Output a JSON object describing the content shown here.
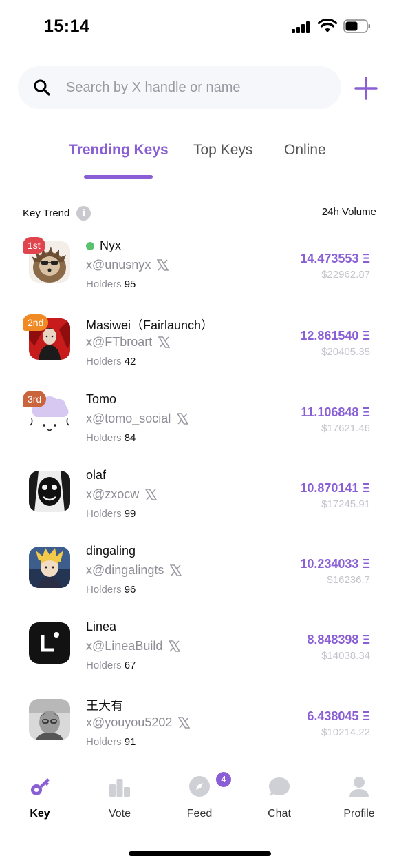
{
  "status_bar": {
    "time": "15:14"
  },
  "search": {
    "placeholder": "Search by X handle or name",
    "value": ""
  },
  "tabs": [
    {
      "label": "Trending Keys",
      "active": true
    },
    {
      "label": "Top Keys",
      "active": false
    },
    {
      "label": "Online",
      "active": false
    }
  ],
  "list_header": {
    "left": "Key Trend",
    "info_glyph": "i",
    "right": "24h Volume"
  },
  "holders_label": "Holders",
  "rows": [
    {
      "rank": "1st",
      "rank_color": "#e0454e",
      "name": "Nyx",
      "online": true,
      "handle": "x@unusnyx",
      "holders": "95",
      "volume": "14.473553 Ξ",
      "usd": "$22962.87",
      "avatar": "hedgehog-avatar"
    },
    {
      "rank": "2nd",
      "rank_color": "#f08a24",
      "name": "Masiwei（Fairlaunch）",
      "online": false,
      "handle": "x@FTbroart",
      "holders": "42",
      "volume": "12.861540 Ξ",
      "usd": "$20405.35",
      "avatar": "red-figure-avatar"
    },
    {
      "rank": "3rd",
      "rank_color": "#c9643c",
      "name": "Tomo",
      "online": false,
      "handle": "x@tomo_social",
      "holders": "84",
      "volume": "11.106848 Ξ",
      "usd": "$17621.46",
      "avatar": "cat-avatar"
    },
    {
      "rank": "",
      "rank_color": "",
      "name": "olaf",
      "online": false,
      "handle": "x@zxocw",
      "holders": "99",
      "volume": "10.870141 Ξ",
      "usd": "$17245.91",
      "avatar": "bw-face-avatar"
    },
    {
      "rank": "",
      "rank_color": "",
      "name": "dingaling",
      "online": false,
      "handle": "x@dingalingts",
      "holders": "96",
      "volume": "10.234033 Ξ",
      "usd": "$16236.7",
      "avatar": "anime-avatar"
    },
    {
      "rank": "",
      "rank_color": "",
      "name": "Linea",
      "online": false,
      "handle": "x@LineaBuild",
      "holders": "67",
      "volume": "8.848398 Ξ",
      "usd": "$14038.34",
      "avatar": "linea-logo-avatar"
    },
    {
      "rank": "",
      "rank_color": "",
      "name": "王大有",
      "online": false,
      "handle": "x@youyou5202",
      "holders": "91",
      "volume": "6.438045 Ξ",
      "usd": "$10214.22",
      "avatar": "bw-photo-avatar"
    }
  ],
  "nav": [
    {
      "label": "Key",
      "icon": "key-icon",
      "active": true
    },
    {
      "label": "Vote",
      "icon": "podium-icon",
      "active": false
    },
    {
      "label": "Feed",
      "icon": "compass-icon",
      "active": false
    },
    {
      "label": "Chat",
      "icon": "chat-bubble-icon",
      "active": false,
      "badge": "4"
    },
    {
      "label": "Profile",
      "icon": "person-icon",
      "active": false
    }
  ],
  "colors": {
    "accent": "#8a5fd6",
    "online": "#5ac26e",
    "muted": "#8d8d95"
  }
}
